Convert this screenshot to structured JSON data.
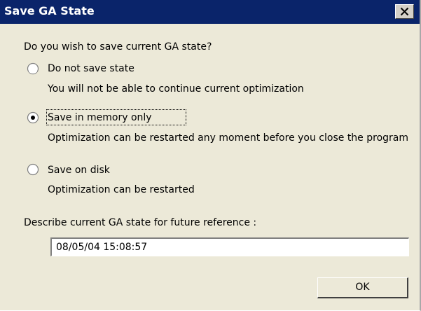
{
  "window": {
    "title": "Save GA State",
    "close_icon": "close-icon",
    "colors": {
      "titlebar": "#0a246a",
      "title_text": "#ffffff",
      "face": "#ece9d8"
    }
  },
  "question": "Do you wish to save current GA state?",
  "options": [
    {
      "label": "Do not save state",
      "description": "You will not be able to continue current optimization",
      "selected": false
    },
    {
      "label": "Save in memory only",
      "description": "Optimization can be restarted any moment before you close the program",
      "selected": true
    },
    {
      "label": "Save on disk",
      "description": "Optimization can be restarted",
      "selected": false
    }
  ],
  "describe": {
    "label": "Describe current GA state for future reference :",
    "value": "08/05/04 15:08:57"
  },
  "ok_label": "OK"
}
